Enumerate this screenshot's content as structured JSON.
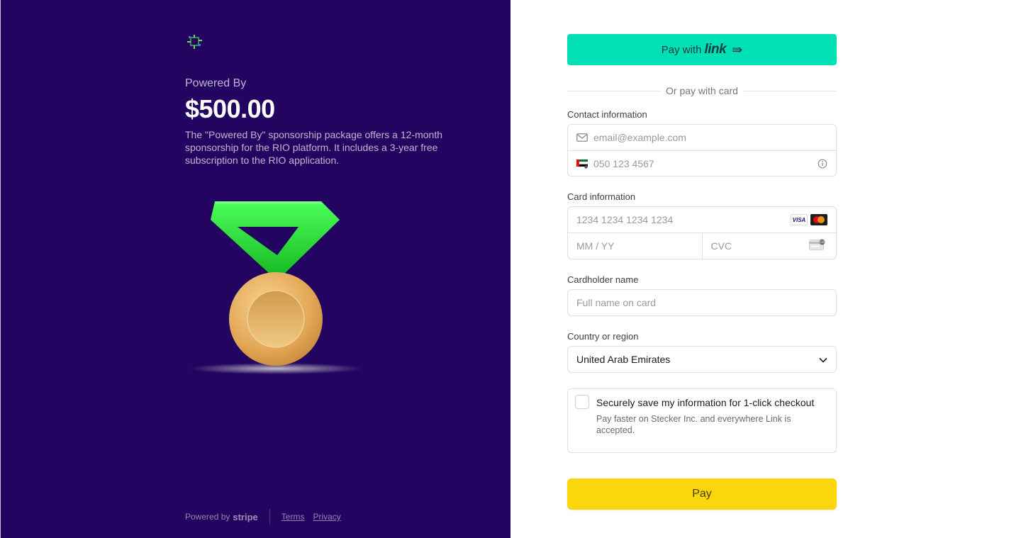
{
  "left": {
    "product_name": "Powered By",
    "price": "$500.00",
    "description": "The \"Powered By\" sponsorship package offers a 12-month sponsorship for the RIO platform. It includes a 3-year free subscription to the RIO application.",
    "footer": {
      "powered_by": "Powered by",
      "stripe": "stripe",
      "terms": "Terms",
      "privacy": "Privacy"
    }
  },
  "right": {
    "link_button": {
      "prefix": "Pay with",
      "brand": "link",
      "arrow": "⇛"
    },
    "or_text": "Or pay with card",
    "contact": {
      "label": "Contact information",
      "email_placeholder": "email@example.com",
      "phone_placeholder": "050 123 4567"
    },
    "card": {
      "label": "Card information",
      "number_placeholder": "1234 1234 1234 1234",
      "expiry_placeholder": "MM / YY",
      "cvc_placeholder": "CVC",
      "visa": "VISA"
    },
    "cardholder": {
      "label": "Cardholder name",
      "placeholder": "Full name on card"
    },
    "country": {
      "label": "Country or region",
      "value": "United Arab Emirates"
    },
    "save": {
      "title": "Securely save my information for 1-click checkout",
      "subtitle": "Pay faster on Stecker Inc. and everywhere Link is accepted."
    },
    "pay_label": "Pay"
  },
  "colors": {
    "left_bg": "#230461",
    "link_accent": "#00e0b5",
    "pay_accent": "#fcd60c",
    "medal_gold": "#e0a95a",
    "ribbon_green": "#1ed12a"
  }
}
